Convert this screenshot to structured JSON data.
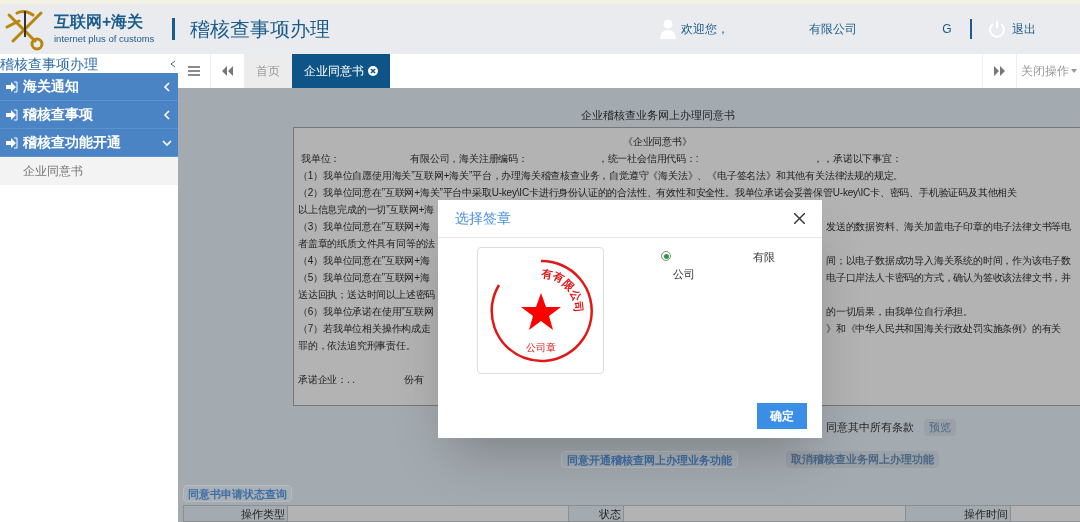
{
  "header": {
    "logo_title": "互联网+海关",
    "logo_subtitle": "internet plus of customs",
    "page_title": "稽核查事项办理",
    "welcome": "欢迎您，",
    "user_parts": [
      "有限公司",
      "G"
    ],
    "logout": "退出"
  },
  "sidebar": {
    "title": "稽核查事项办理",
    "items": [
      {
        "label": "海关通知",
        "expanded": false
      },
      {
        "label": "稽核查事项",
        "expanded": false
      },
      {
        "label": "稽核查功能开通",
        "expanded": true,
        "children": [
          {
            "label": "企业同意书"
          }
        ]
      }
    ]
  },
  "tabs": [
    {
      "label": "首页",
      "selected": false,
      "closable": false
    },
    {
      "label": "企业同意书",
      "selected": true,
      "closable": true
    }
  ],
  "tab_bar": {
    "close_menu": "关闭操作"
  },
  "document": {
    "heading": "企业稽核查业务网上办理同意书",
    "title": "《企业同意书》",
    "lines": [
      {
        "kind": "parts",
        "parts": [
          "我单位：",
          "有限公司，海关注册编码：",
          "，统一社会信用代码：:",
          "，，承诺以下事宜："
        ]
      },
      {
        "kind": "full",
        "text": "（1）我单位自愿使用海关”互联网+海关”平台，办理海关稽查核查业务，自觉遵守《海关法》、《电子签名法》和其他有关法律法规的规定。"
      },
      {
        "kind": "full",
        "text": "（2）我单位同意在”互联网+海关”平台中采取U-key\\IC卡进行身份认证的的合法性、有效性和安全性。我单位承诺会妥善保管U-key\\IC卡、密码、手机验证码及其他相关"
      },
      {
        "kind": "split",
        "left": "以上信息完成的一切”互联网+海"
      },
      {
        "kind": "split",
        "left": "（3）我单位同意在”互联网+海",
        "right": "发送的数据资料、海关加盖电子印章的电子法律文书等电"
      },
      {
        "kind": "split",
        "left": "者盖章的纸质文件具有同等的法"
      },
      {
        "kind": "split",
        "left": "（4）我单位同意在”互联网+海",
        "right": "间；以电子数据成功导入海关系统的时间，作为该电子数"
      },
      {
        "kind": "split",
        "left": "（5）我单位同意在”互联网+海",
        "right": "电子口岸法人卡密码的方式，确认为签收该法律文书，并"
      },
      {
        "kind": "split",
        "left": "送达回执；送达时间以上述密码"
      },
      {
        "kind": "split",
        "left": "（6）我单位承诺在使用”互联网",
        "right": "的一切后果，由我单位自行承担。"
      },
      {
        "kind": "split",
        "left": "（7）若我单位相关操作构成走",
        "right": "》和《中华人民共和国海关行政处罚实施条例》的有关"
      },
      {
        "kind": "split",
        "left": "罪的，依法追究刑事责任。"
      },
      {
        "kind": "blank"
      },
      {
        "kind": "parts",
        "parts": [
          "承诺企业：. .",
          "份有"
        ]
      }
    ]
  },
  "agree_text": "同意其中所有条款",
  "preview": {
    "label": "预览",
    "disabled": true
  },
  "buttons": [
    {
      "label": "同意开通稽核查网上办理业务功能",
      "disabled": false
    },
    {
      "label": "取消稽核查业务网上办理功能",
      "disabled": true
    }
  ],
  "query_button": "同意书申请状态查询",
  "table": {
    "columns": [
      "操作类型",
      "状态",
      "操作时间"
    ]
  },
  "dialog": {
    "title": "选择签章",
    "seal_text": "有有限公司",
    "seal_label": "公司章",
    "options": [
      {
        "label": "有限公司",
        "selected": true
      }
    ],
    "ok": "确定"
  }
}
